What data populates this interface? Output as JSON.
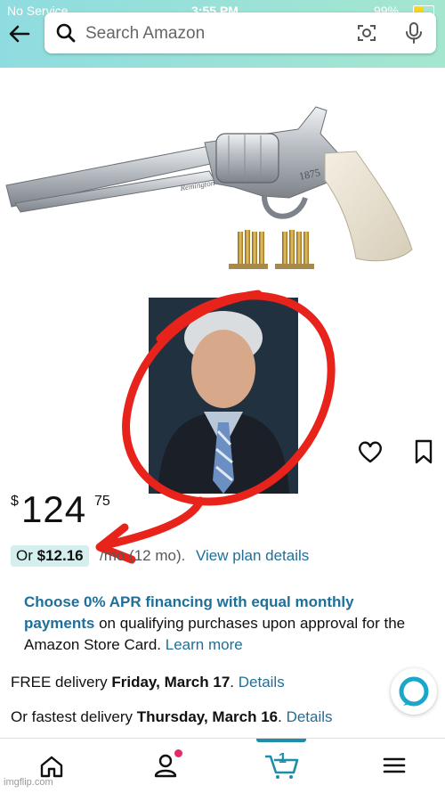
{
  "status_bar": {
    "carrier": "No Service",
    "time": "3:55 PM",
    "battery": "99%"
  },
  "search": {
    "placeholder": "Search Amazon"
  },
  "product": {
    "revolver_engraving": "Remington",
    "revolver_model": "1875",
    "price_symbol": "$",
    "price_whole": "124",
    "price_fraction": "75",
    "monthly_prefix": "Or ",
    "monthly_amount": "$12.16",
    "monthly_term": "/mo (12 mo).",
    "monthly_link": "View plan details"
  },
  "financing": {
    "bold": "Choose 0% APR financing with equal monthly",
    "bold_link": "payments",
    "text": " on qualifying purchases upon approval for the Amazon Store Card. ",
    "link": "Learn more"
  },
  "delivery": {
    "free_prefix": "FREE delivery ",
    "free_date": "Friday, March 17",
    "free_sep": ". ",
    "free_link": "Details",
    "fast_prefix": "Or fastest delivery ",
    "fast_date": "Thursday, March 16",
    "fast_sep": ". ",
    "fast_link": "Details"
  },
  "cart": {
    "count": "1"
  },
  "watermark": "imgflip.com",
  "colors": {
    "accent_teal": "#1f6f98",
    "annotation_red": "#e8231b",
    "header_gradient_start": "#8fdce0",
    "notification_pink": "#e02e6b"
  },
  "icons": [
    "back-arrow-icon",
    "search-icon",
    "camera-icon",
    "mic-icon",
    "heart-icon",
    "bookmark-icon",
    "alexa-icon",
    "home-icon",
    "account-icon",
    "cart-icon",
    "menu-icon"
  ]
}
